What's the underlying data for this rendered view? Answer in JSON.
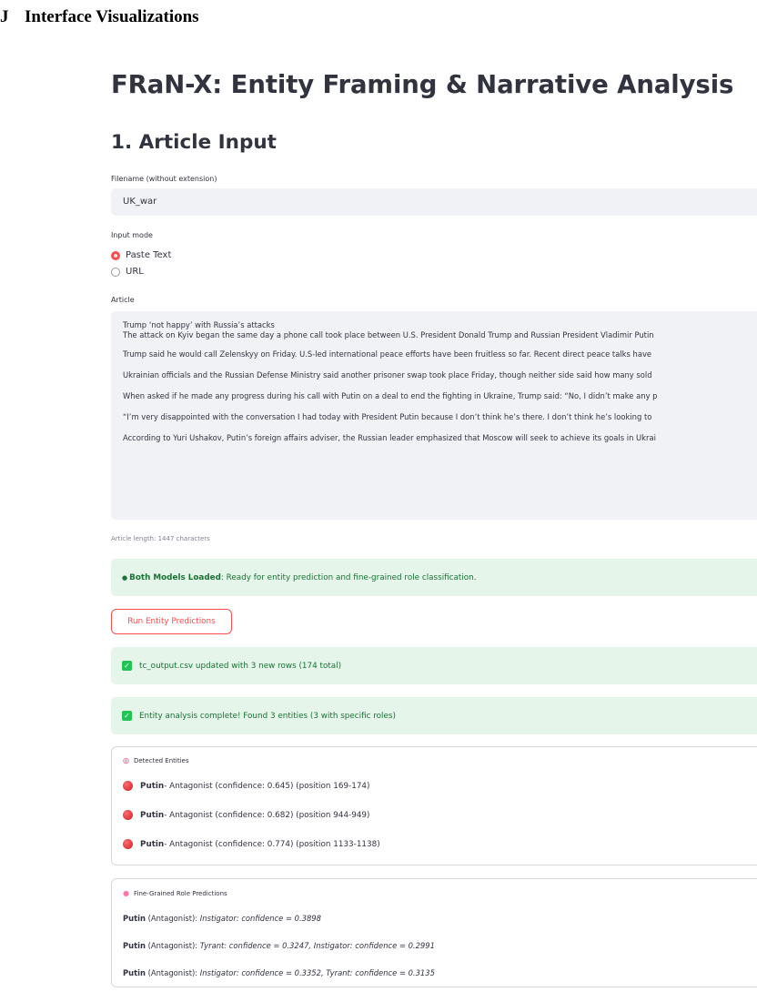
{
  "appendix": {
    "number": "J",
    "title": "Interface Visualizations"
  },
  "app": {
    "title": "FRaN-X: Entity Framing & Narrative Analysis",
    "section_title": "1. Article Input"
  },
  "filename_field": {
    "label": "Filename (without extension)",
    "value": "UK_war"
  },
  "input_mode": {
    "label": "Input mode",
    "options": [
      {
        "label": "Paste Text",
        "selected": true
      },
      {
        "label": "URL",
        "selected": false
      }
    ]
  },
  "article": {
    "label": "Article",
    "paragraphs": [
      "Trump ‘not happy’ with Russia’s attacks",
      "The attack on Kyiv began the same day a phone call took place between U.S. President Donald Trump and Russian President Vladimir Putin",
      "Trump said he would call Zelenskyy on Friday. U.S-led international peace efforts have been fruitless so far. Recent direct peace talks have",
      "Ukrainian officials and the Russian Defense Ministry said another prisoner swap took place Friday, though neither side said how many sold",
      "When asked if he made any progress during his call with Putin on a deal to end the fighting in Ukraine, Trump said: “No, I didn’t make any p",
      "“I’m very disappointed with the conversation I had today with President Putin because I don’t think he’s there. I don’t think he’s looking to",
      "According to Yuri Ushakov, Putin’s foreign affairs adviser, the Russian leader emphasized that Moscow will seek to achieve its goals in Ukrai"
    ],
    "length_text": "Article length: 1447 characters"
  },
  "models_status": {
    "icon": "green-circle-icon",
    "bold": "Both Models Loaded",
    "text": ": Ready for entity prediction and fine-grained role classification."
  },
  "run_button": {
    "label": "Run Entity Predictions"
  },
  "success_messages": [
    {
      "icon": "check-box-icon",
      "text": "tc_output.csv updated with 3 new rows (174 total)"
    },
    {
      "icon": "check-box-icon",
      "text": "Entity analysis complete! Found 3 entities (3 with specific roles)"
    }
  ],
  "detected_entities": {
    "icon": "target-icon",
    "title": "Detected Entities",
    "items": [
      {
        "name": "Putin",
        "detail": " - Antagonist (confidence: 0.645) (position 169-174)"
      },
      {
        "name": "Putin",
        "detail": " - Antagonist (confidence: 0.682) (position 944-949)"
      },
      {
        "name": "Putin",
        "detail": " - Antagonist (confidence: 0.774) (position 1133-1138)"
      }
    ]
  },
  "fine_grained": {
    "icon": "brain-icon",
    "title": "Fine-Grained Role Predictions",
    "items": [
      {
        "name": "Putin",
        "role": " (Antagonist): ",
        "preds": "Instigator: confidence = 0.3898"
      },
      {
        "name": "Putin",
        "role": " (Antagonist): ",
        "preds": "Tyrant: confidence = 0.3247, Instigator: confidence = 0.2991"
      },
      {
        "name": "Putin",
        "role": " (Antagonist): ",
        "preds": "Instigator: confidence = 0.3352, Tyrant: confidence = 0.3135"
      }
    ]
  },
  "colors": {
    "accent": "#ff4b4b",
    "success_bg": "#e6f5ea",
    "success_text": "#177233",
    "input_bg": "#f0f2f6"
  }
}
